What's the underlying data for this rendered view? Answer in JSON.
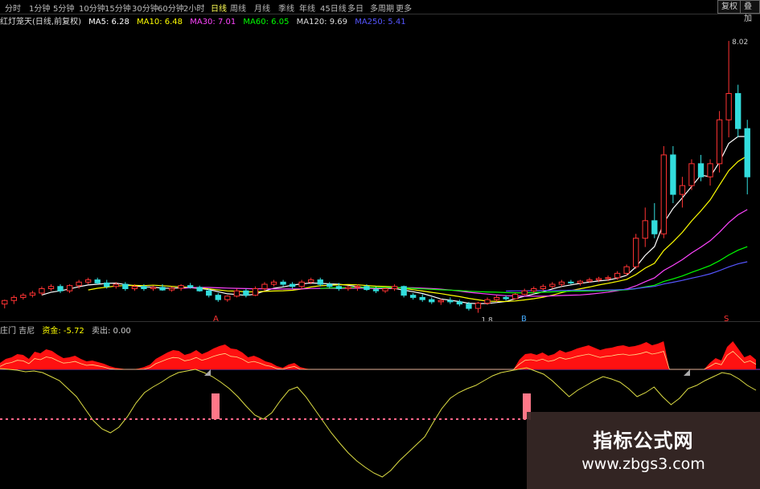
{
  "toolbar": {
    "periods": [
      "分时",
      "1分钟",
      "5分钟",
      "10分钟",
      "15分钟",
      "30分钟",
      "60分钟",
      "2小时",
      "日线",
      "周线",
      "月线",
      "季线",
      "年线",
      "45日线",
      "多日",
      "多周期",
      "更多"
    ],
    "active_period": "日线",
    "right_buttons": [
      "复权",
      "叠加"
    ]
  },
  "ma_legend": {
    "title": "红灯笼天(日线,前复权)",
    "items": [
      {
        "label": "MA5: 6.28",
        "color": "#ffffff"
      },
      {
        "label": "MA10: 6.48",
        "color": "#ffff00"
      },
      {
        "label": "MA30: 7.01",
        "color": "#ff44ff"
      },
      {
        "label": "MA60: 6.05",
        "color": "#00ff00"
      },
      {
        "label": "MA120: 9.69",
        "color": "#dddddd"
      },
      {
        "label": "MA250: 5.41",
        "color": "#5555ff"
      }
    ]
  },
  "price_labels": {
    "high": "8.02",
    "low": "1.8"
  },
  "markers": {
    "sell_main": "A",
    "buy_main": "B",
    "sell_right": "S"
  },
  "indicator_legend": {
    "items": [
      {
        "label": "庄门 吉尼",
        "color": "#cccccc"
      },
      {
        "label": "资金: -5.72",
        "color": "#ffff00"
      },
      {
        "label": "卖出: 0.00",
        "color": "#cccccc"
      }
    ]
  },
  "watermark": {
    "title": "指标公式网",
    "url": "www.zbgs3.com"
  },
  "chart_data": {
    "type": "candlestick",
    "up_color": "#ff3333",
    "down_color": "#33dddd",
    "price_range": [
      1.7,
      8.2
    ],
    "candles": [
      [
        2.0,
        2.1,
        1.9,
        2.08
      ],
      [
        2.08,
        2.2,
        2.0,
        2.15
      ],
      [
        2.15,
        2.25,
        2.1,
        2.2
      ],
      [
        2.2,
        2.3,
        2.15,
        2.25
      ],
      [
        2.25,
        2.4,
        2.2,
        2.35
      ],
      [
        2.35,
        2.45,
        2.3,
        2.4
      ],
      [
        2.4,
        2.45,
        2.25,
        2.3
      ],
      [
        2.3,
        2.45,
        2.25,
        2.42
      ],
      [
        2.42,
        2.55,
        2.35,
        2.5
      ],
      [
        2.5,
        2.6,
        2.45,
        2.55
      ],
      [
        2.55,
        2.6,
        2.45,
        2.48
      ],
      [
        2.48,
        2.55,
        2.35,
        2.4
      ],
      [
        2.4,
        2.5,
        2.35,
        2.45
      ],
      [
        2.45,
        2.5,
        2.3,
        2.35
      ],
      [
        2.35,
        2.45,
        2.3,
        2.4
      ],
      [
        2.4,
        2.45,
        2.3,
        2.35
      ],
      [
        2.35,
        2.42,
        2.3,
        2.38
      ],
      [
        2.38,
        2.45,
        2.3,
        2.32
      ],
      [
        2.32,
        2.4,
        2.28,
        2.36
      ],
      [
        2.36,
        2.45,
        2.3,
        2.42
      ],
      [
        2.42,
        2.48,
        2.35,
        2.38
      ],
      [
        2.38,
        2.42,
        2.28,
        2.3
      ],
      [
        2.3,
        2.35,
        2.15,
        2.2
      ],
      [
        2.2,
        2.25,
        2.05,
        2.1
      ],
      [
        2.1,
        2.2,
        2.05,
        2.18
      ],
      [
        2.18,
        2.35,
        2.15,
        2.3
      ],
      [
        2.3,
        2.35,
        2.15,
        2.2
      ],
      [
        2.2,
        2.4,
        2.18,
        2.35
      ],
      [
        2.35,
        2.5,
        2.3,
        2.45
      ],
      [
        2.45,
        2.55,
        2.4,
        2.5
      ],
      [
        2.5,
        2.55,
        2.4,
        2.45
      ],
      [
        2.45,
        2.5,
        2.35,
        2.4
      ],
      [
        2.4,
        2.55,
        2.35,
        2.5
      ],
      [
        2.5,
        2.6,
        2.45,
        2.55
      ],
      [
        2.55,
        2.6,
        2.4,
        2.45
      ],
      [
        2.45,
        2.5,
        2.35,
        2.4
      ],
      [
        2.4,
        2.48,
        2.3,
        2.35
      ],
      [
        2.35,
        2.42,
        2.3,
        2.38
      ],
      [
        2.38,
        2.45,
        2.3,
        2.4
      ],
      [
        2.4,
        2.45,
        2.3,
        2.33
      ],
      [
        2.33,
        2.4,
        2.25,
        2.3
      ],
      [
        2.3,
        2.38,
        2.25,
        2.35
      ],
      [
        2.35,
        2.45,
        2.3,
        2.4
      ],
      [
        2.4,
        2.42,
        2.15,
        2.2
      ],
      [
        2.2,
        2.25,
        2.1,
        2.15
      ],
      [
        2.15,
        2.22,
        2.05,
        2.1
      ],
      [
        2.1,
        2.15,
        2.0,
        2.05
      ],
      [
        2.05,
        2.12,
        1.98,
        2.08
      ],
      [
        2.08,
        2.15,
        2.0,
        2.05
      ],
      [
        2.05,
        2.1,
        1.95,
        2.0
      ],
      [
        2.0,
        2.05,
        1.85,
        1.9
      ],
      [
        1.9,
        2.05,
        1.8,
        2.02
      ],
      [
        2.02,
        2.15,
        1.98,
        2.1
      ],
      [
        2.1,
        2.2,
        2.05,
        2.15
      ],
      [
        2.15,
        2.2,
        2.08,
        2.12
      ],
      [
        2.12,
        2.25,
        2.1,
        2.22
      ],
      [
        2.22,
        2.35,
        2.2,
        2.3
      ],
      [
        2.3,
        2.4,
        2.25,
        2.35
      ],
      [
        2.35,
        2.45,
        2.3,
        2.4
      ],
      [
        2.4,
        2.5,
        2.35,
        2.45
      ],
      [
        2.45,
        2.55,
        2.4,
        2.5
      ],
      [
        2.5,
        2.55,
        2.45,
        2.48
      ],
      [
        2.48,
        2.55,
        2.42,
        2.52
      ],
      [
        2.52,
        2.6,
        2.48,
        2.55
      ],
      [
        2.55,
        2.62,
        2.5,
        2.58
      ],
      [
        2.58,
        2.65,
        2.52,
        2.6
      ],
      [
        2.6,
        2.75,
        2.55,
        2.7
      ],
      [
        2.7,
        2.9,
        2.65,
        2.85
      ],
      [
        2.85,
        3.6,
        2.8,
        3.5
      ],
      [
        3.5,
        4.2,
        3.3,
        3.9
      ],
      [
        3.9,
        4.3,
        3.5,
        3.6
      ],
      [
        3.6,
        5.6,
        3.5,
        5.4
      ],
      [
        5.4,
        5.6,
        4.3,
        4.5
      ],
      [
        4.5,
        4.9,
        4.2,
        4.7
      ],
      [
        4.7,
        5.3,
        4.6,
        5.2
      ],
      [
        5.2,
        5.4,
        4.8,
        4.9
      ],
      [
        4.9,
        5.3,
        4.7,
        5.2
      ],
      [
        5.2,
        6.4,
        5.0,
        6.2
      ],
      [
        6.2,
        8.0,
        5.8,
        6.8
      ],
      [
        6.8,
        7.0,
        5.8,
        6.0
      ],
      [
        6.0,
        6.2,
        4.5,
        4.9
      ]
    ],
    "indicator": {
      "area_values": [
        8,
        13,
        15,
        19,
        18,
        13,
        22,
        20,
        25,
        23,
        18,
        14,
        15,
        17,
        13,
        10,
        11,
        9,
        7,
        4,
        2,
        1,
        0,
        0,
        1,
        3,
        6,
        13,
        17,
        21,
        24,
        23,
        18,
        20,
        24,
        19,
        22,
        26,
        29,
        31,
        26,
        25,
        21,
        15,
        17,
        14,
        10,
        8,
        4,
        2,
        6,
        8,
        3,
        1,
        0,
        0,
        0,
        0,
        0,
        0,
        0,
        0,
        0,
        0,
        0,
        0,
        0,
        0,
        0,
        0,
        0,
        0,
        0,
        0,
        0,
        0,
        0,
        0,
        0,
        0,
        0,
        0,
        0,
        0,
        0,
        0,
        0,
        0,
        0,
        0,
        12,
        19,
        20,
        18,
        21,
        17,
        19,
        24,
        21,
        23,
        26,
        28,
        30,
        27,
        24,
        26,
        27,
        29,
        30,
        28,
        29,
        31,
        34,
        30,
        32,
        35,
        0,
        0,
        0,
        0,
        0,
        0,
        0,
        8,
        14,
        11,
        28,
        35,
        25,
        15,
        18,
        12
      ]
    }
  }
}
